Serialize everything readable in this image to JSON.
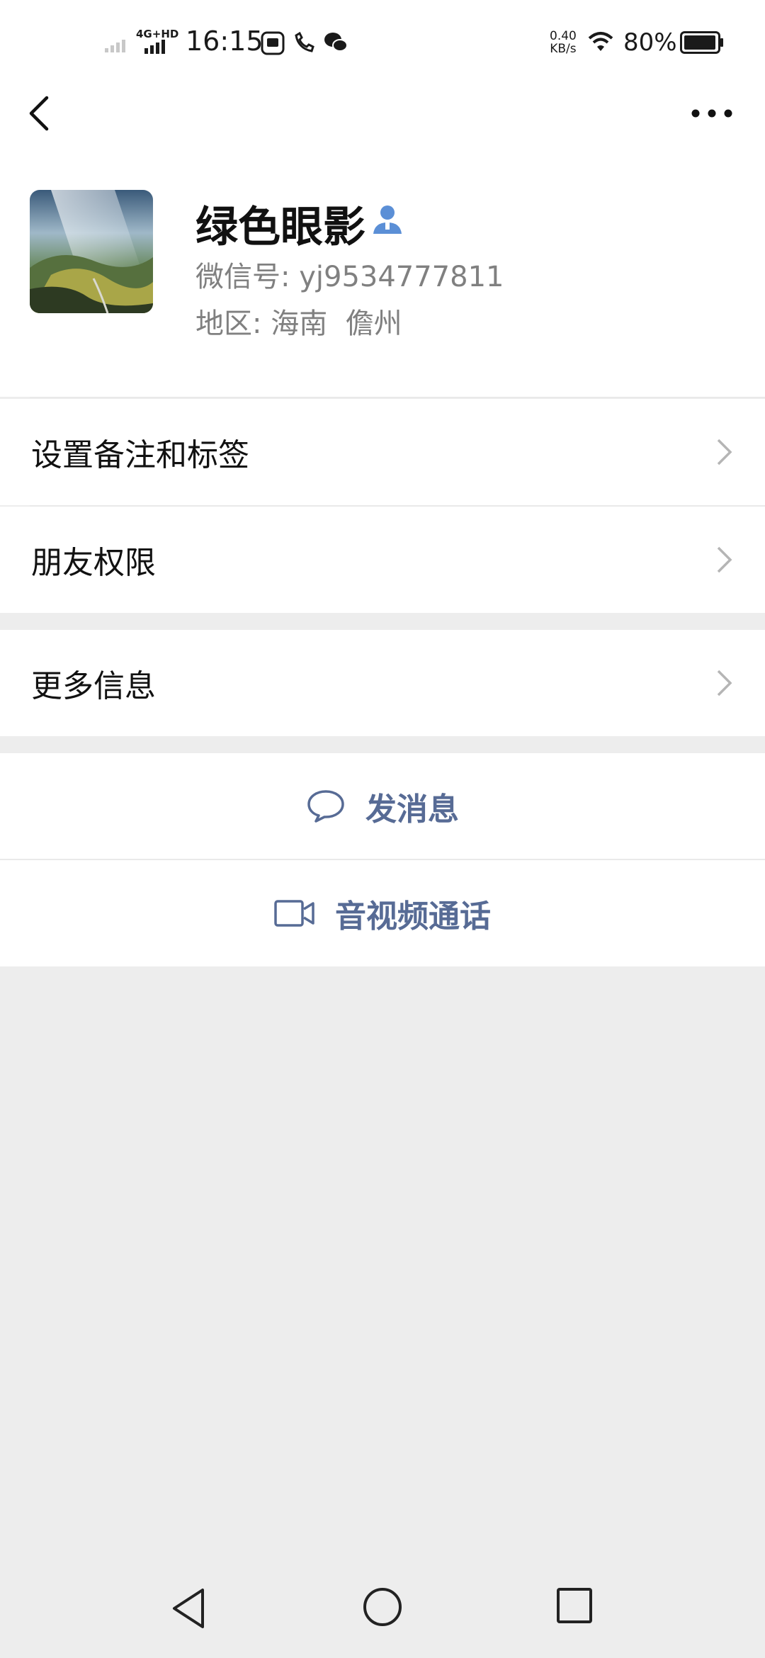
{
  "status_bar": {
    "network_type": "4G+HD",
    "time": "16:15",
    "net_speed_value": "0.40",
    "net_speed_unit": "KB/s",
    "battery_percent": "80%",
    "battery_level": 0.8
  },
  "header": {
    "back_icon": "chevron-left-icon",
    "more_icon": "more-dots-icon"
  },
  "profile": {
    "nickname": "绿色眼影",
    "wechat_id_label": "微信号:",
    "wechat_id": "yj9534777811",
    "region_label": "地区:",
    "region": "海南  儋州"
  },
  "menu": {
    "items": [
      {
        "label": "设置备注和标签"
      },
      {
        "label": "朋友权限"
      },
      {
        "label": "更多信息"
      }
    ]
  },
  "actions": {
    "message": "发消息",
    "video_call": "音视频通话"
  },
  "colors": {
    "accent_link": "#576b95",
    "background": "#ededed",
    "person_icon": "#5b8fd6"
  }
}
